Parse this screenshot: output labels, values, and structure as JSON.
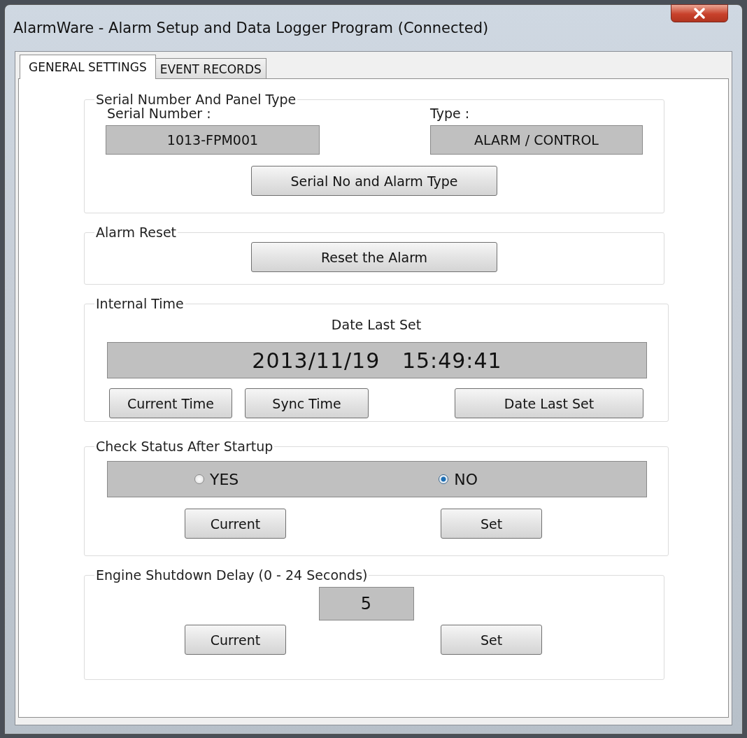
{
  "window": {
    "title": "AlarmWare - Alarm Setup and Data Logger Program (Connected)"
  },
  "tabs": [
    {
      "label": "GENERAL SETTINGS",
      "selected": true
    },
    {
      "label": "EVENT RECORDS",
      "selected": false
    }
  ],
  "serial_group": {
    "title": "Serial Number And Panel Type",
    "serial_label": "Serial Number :",
    "serial_value": "1013-FPM001",
    "type_label": "Type :",
    "type_value": "ALARM / CONTROL",
    "button": "Serial No and Alarm Type"
  },
  "reset_group": {
    "title": "Alarm Reset",
    "button": "Reset the Alarm"
  },
  "time_group": {
    "title": "Internal Time",
    "caption": "Date Last Set",
    "date": "2013/11/19",
    "time": "15:49:41",
    "buttons": [
      "Current Time",
      "Sync Time",
      "Date Last Set"
    ]
  },
  "status_group": {
    "title": "Check Status After Startup",
    "options": [
      {
        "label": "YES",
        "selected": false
      },
      {
        "label": "NO",
        "selected": true
      }
    ],
    "buttons": [
      "Current",
      "Set"
    ]
  },
  "delay_group": {
    "title": "Engine Shutdown Delay (0 - 24 Seconds)",
    "value": "5",
    "buttons": [
      "Current",
      "Set"
    ]
  }
}
